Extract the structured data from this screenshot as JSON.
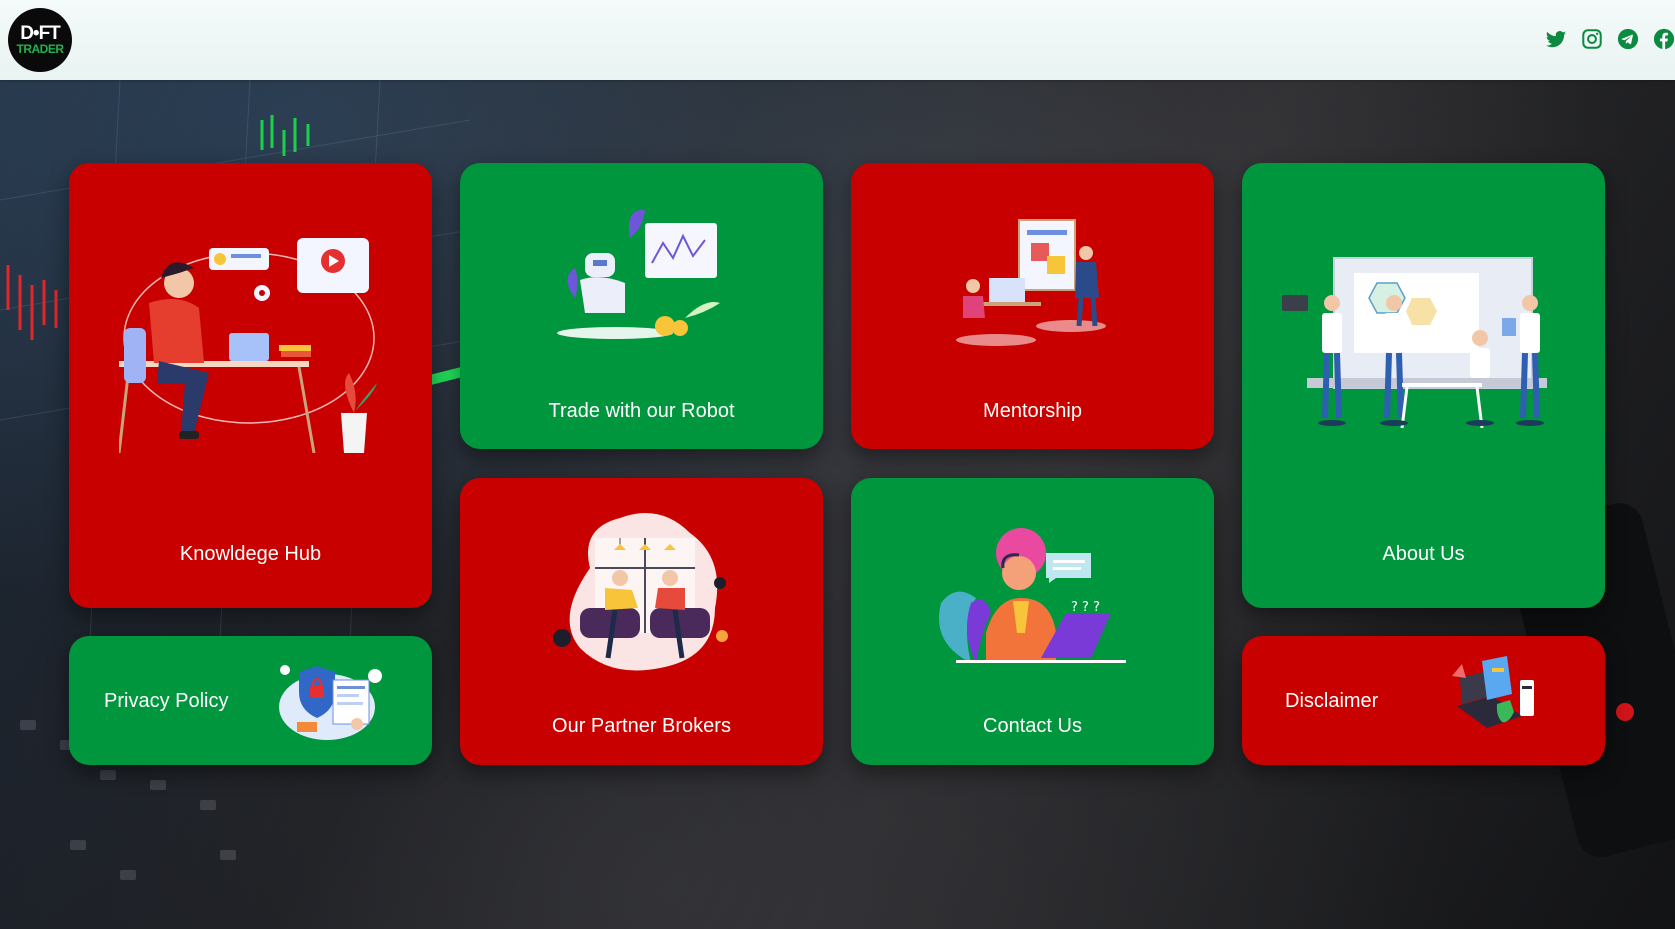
{
  "header": {
    "logo": {
      "top": "D•FT",
      "bottom": "TRADER"
    },
    "social_icons": [
      "twitter-icon",
      "instagram-icon",
      "telegram-icon",
      "facebook-icon"
    ]
  },
  "cards": {
    "knowledge_hub": {
      "label": "Knowldege Hub",
      "color": "#c80000"
    },
    "trade_robot": {
      "label": "Trade with our Robot",
      "color": "#00963e"
    },
    "mentorship": {
      "label": "Mentorship",
      "color": "#c80000"
    },
    "about_us": {
      "label": "About Us",
      "color": "#00963e"
    },
    "privacy_policy": {
      "label": "Privacy Policy",
      "color": "#00963e"
    },
    "partner_brokers": {
      "label": "Our Partner Brokers",
      "color": "#c80000"
    },
    "contact_us": {
      "label": "Contact Us",
      "color": "#00963e"
    },
    "disclaimer": {
      "label": "Disclaimer",
      "color": "#c80000"
    }
  },
  "colors": {
    "red": "#c80000",
    "green": "#00963e",
    "header_bg": "#f0f8f6"
  }
}
